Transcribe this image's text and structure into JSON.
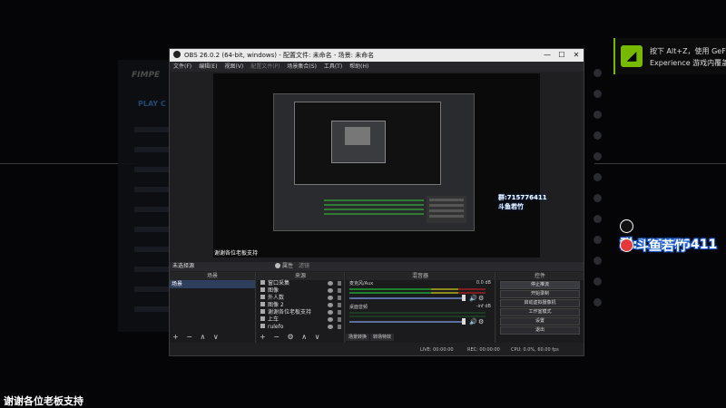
{
  "obs": {
    "title": "OBS 26.0.2 (64-bit, windows) - 配置文件: 未命名 - 场景: 未命名",
    "window_buttons": {
      "minimize": "—",
      "maximize": "☐",
      "close": "✕"
    },
    "menu": [
      "文件(F)",
      "编辑(E)",
      "视图(V)",
      "配置文件(P)",
      "场景集合(S)",
      "工具(T)",
      "帮助(H)"
    ],
    "preview_caption": "谢谢各位老板支持",
    "scene_bar": {
      "left": "未选择源",
      "properties": "属性",
      "filters": "滤镜"
    },
    "docks": {
      "scenes_header": "场景",
      "sources_header": "来源",
      "mixer_header": "混音器",
      "controls_header": "控件"
    },
    "scenes": [
      "场景"
    ],
    "sources": [
      "窗口采集",
      "图像",
      "外人数",
      "图像 2",
      "谢谢各位老板支持",
      "上车",
      "rulefo"
    ],
    "mixer": {
      "channels": [
        {
          "name": "麦克风/Aux",
          "db": "0.0 dB"
        },
        {
          "name": "桌面音频",
          "db": "-inf dB"
        }
      ],
      "tabs": [
        "场景转换",
        "转场特效"
      ]
    },
    "controls": [
      "停止推流",
      "开始录制",
      "启动虚拟摄像机",
      "工作室模式",
      "设置",
      "退出"
    ],
    "dock_footer": "+ − ∧ ∨",
    "source_footer": "+ − ⚙ ∧ ∨",
    "status": {
      "live": "LIVE: 00:00:00",
      "rec": "REC: 00:00:00",
      "cpu": "CPU: 0.0%, 60.00 fps"
    }
  },
  "nvidia": {
    "line1": "按下 Alt+Z，使用 GeForce",
    "line2": "Experience 游戏内覆盖"
  },
  "social": {
    "qq": "群:715776411",
    "weibo": "斗鱼若竹"
  },
  "nested_social": {
    "qq": "群:715776411",
    "weibo": "斗鱼若竹"
  },
  "caption": "谢谢各位老板支持",
  "behind_app": {
    "logo": "FIMPE",
    "label": "PLAY C"
  },
  "colors": {
    "accent_green": "#76b900",
    "qq_blue": "#1e5fd0",
    "weibo_red": "#e23a3a"
  }
}
